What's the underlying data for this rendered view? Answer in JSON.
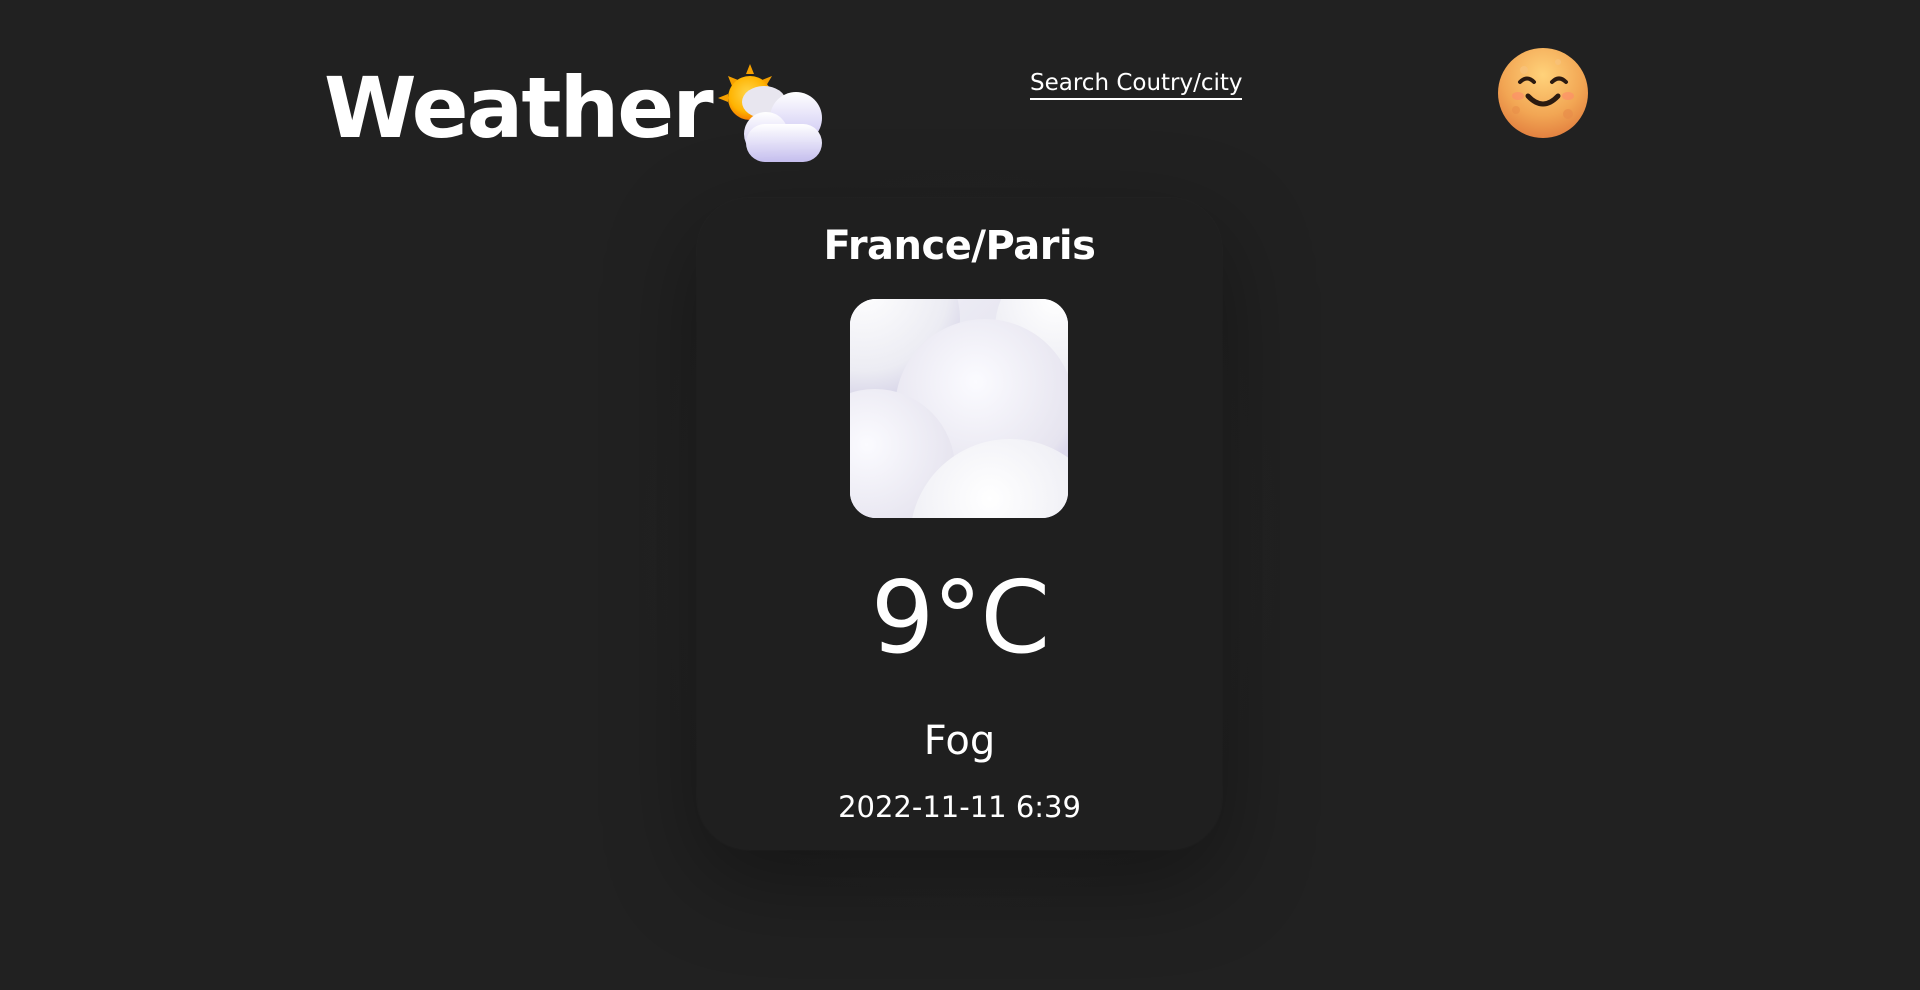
{
  "header": {
    "title": "Weather",
    "logo_icon": "sun-behind-cloud-icon",
    "search": {
      "placeholder": "Search Coutry/city",
      "value": ""
    },
    "avatar_icon": "smiling-moon-face-icon"
  },
  "card": {
    "location": "France/Paris",
    "condition_icon": "fog-clouds-icon",
    "temperature": "9°C",
    "condition": "Fog",
    "datetime": "2022-11-11 6:39"
  },
  "colors": {
    "background": "#212121",
    "card": "#1f1f1f",
    "text": "#ffffff"
  }
}
